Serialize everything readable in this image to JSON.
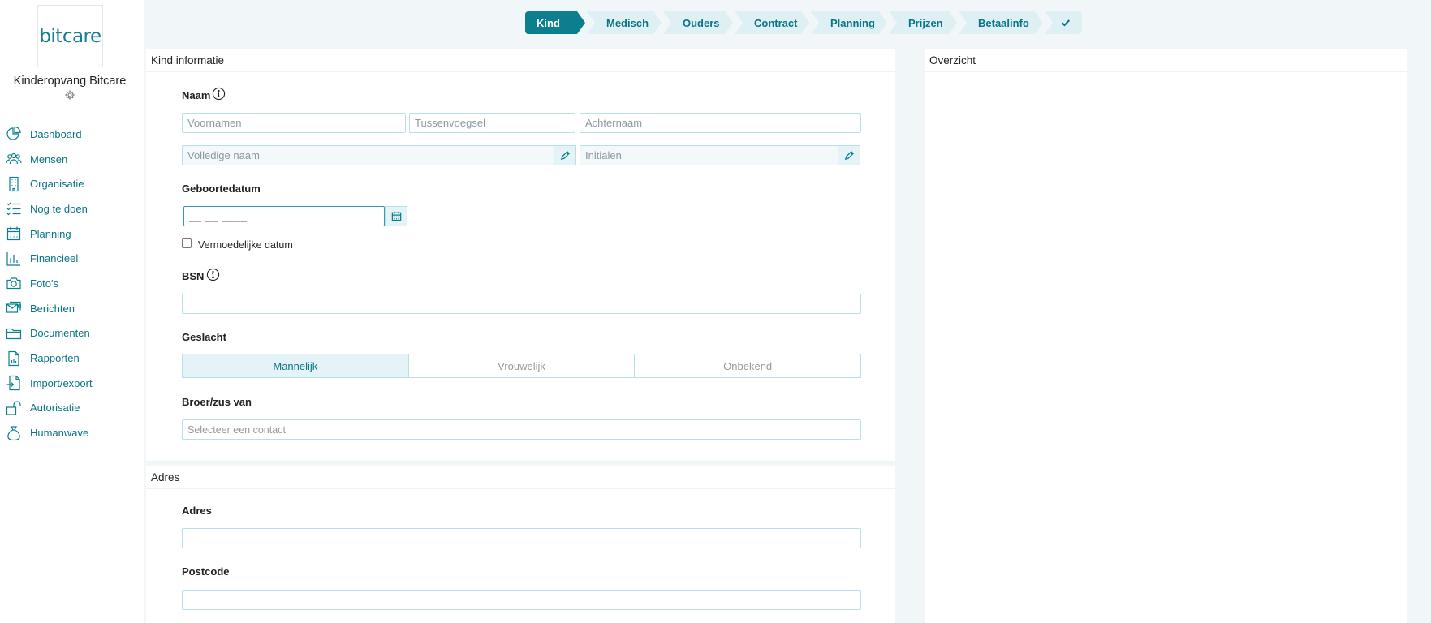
{
  "sidebar": {
    "logo_text": "bitcare",
    "org_name": "Kinderopvang Bitcare",
    "nav": [
      {
        "label": "Dashboard",
        "icon": "pie-chart-icon"
      },
      {
        "label": "Mensen",
        "icon": "people-icon"
      },
      {
        "label": "Organisatie",
        "icon": "building-icon"
      },
      {
        "label": "Nog te doen",
        "icon": "checklist-icon"
      },
      {
        "label": "Planning",
        "icon": "calendar-icon"
      },
      {
        "label": "Financieel",
        "icon": "bar-chart-icon"
      },
      {
        "label": "Foto's",
        "icon": "camera-icon"
      },
      {
        "label": "Berichten",
        "icon": "messages-icon"
      },
      {
        "label": "Documenten",
        "icon": "folder-icon"
      },
      {
        "label": "Rapporten",
        "icon": "report-icon"
      },
      {
        "label": "Import/export",
        "icon": "import-export-icon"
      },
      {
        "label": "Autorisatie",
        "icon": "unlock-icon"
      },
      {
        "label": "Humanwave",
        "icon": "bag-icon"
      }
    ]
  },
  "stepper": {
    "steps": [
      "Kind",
      "Medisch",
      "Ouders",
      "Contract",
      "Planning",
      "Prijzen",
      "Betaalinfo"
    ],
    "active": "Kind",
    "final_icon": "check-icon"
  },
  "kind": {
    "title": "Kind informatie",
    "naam_label": "Naam",
    "voornamen_placeholder": "Voornamen",
    "tussenvoegsel_placeholder": "Tussenvoegsel",
    "achternaam_placeholder": "Achternaam",
    "volledige_naam_placeholder": "Volledige naam",
    "initialen_placeholder": "Initialen",
    "geboortedatum_label": "Geboortedatum",
    "geboortedatum_value": "__-__-____",
    "vermoedelijk_label": "Vermoedelijke datum",
    "bsn_label": "BSN",
    "bsn_value": "",
    "geslacht_label": "Geslacht",
    "geslacht_options": [
      "Mannelijk",
      "Vrouwelijk",
      "Onbekend"
    ],
    "geslacht_selected": "Mannelijk",
    "broer_label": "Broer/zus van",
    "broer_placeholder": "Selecteer een contact"
  },
  "adres": {
    "title": "Adres",
    "adres_label": "Adres",
    "adres_value": "",
    "postcode_label": "Postcode",
    "postcode_value": ""
  },
  "overzicht": {
    "title": "Overzicht"
  },
  "colors": {
    "accent": "#0b7f8e",
    "accent_light": "#e4f3f7",
    "border": "#b9dfe8"
  }
}
